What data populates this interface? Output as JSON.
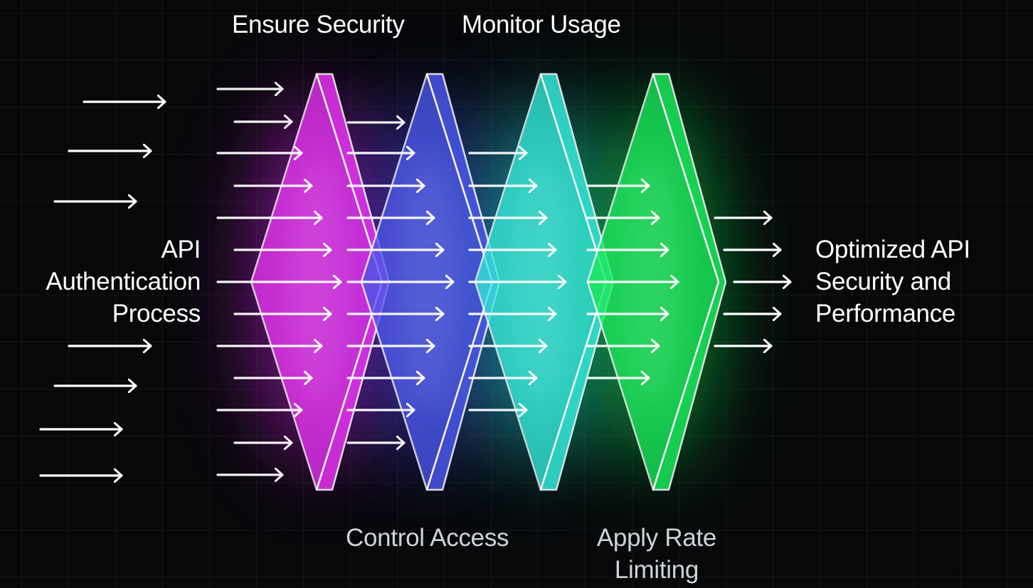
{
  "input_label": [
    "API",
    "Authentication",
    "Process"
  ],
  "output_label": [
    "Optimized API",
    "Security and",
    "Performance"
  ],
  "stages": [
    {
      "label": "Ensure Security",
      "label_position": "top",
      "color": "#e633f0",
      "glow": "#c21ad8"
    },
    {
      "label": "Control Access",
      "label_position": "bottom",
      "color": "#4a55e8",
      "glow": "#3a3fe0"
    },
    {
      "label": "Monitor Usage",
      "label_position": "top",
      "color": "#34e8d9",
      "glow": "#1fd6cf"
    },
    {
      "label": "Apply Rate\nLimiting",
      "label_position": "bottom",
      "color": "#19e85a",
      "glow": "#0fd64a"
    }
  ],
  "colors": {
    "background": "#07080a",
    "arrow": "#ffffff",
    "outline": "#ffffff"
  }
}
